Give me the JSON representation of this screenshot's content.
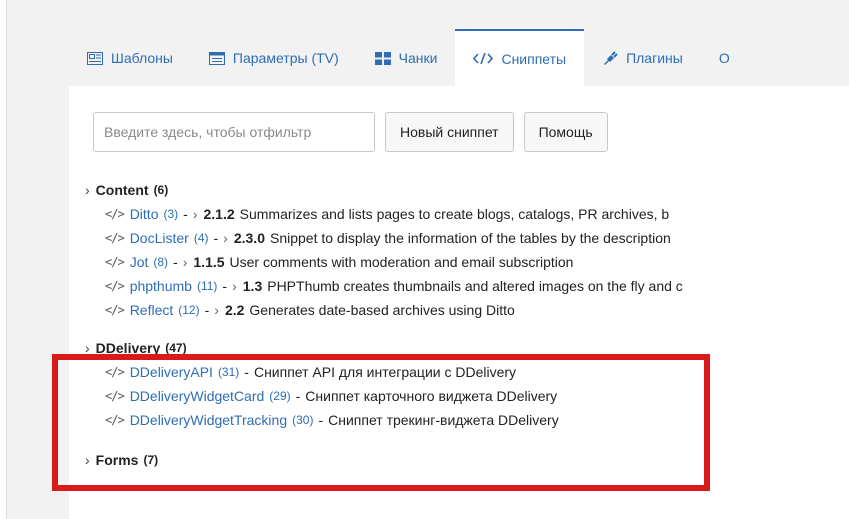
{
  "tabs": [
    {
      "label": "Шаблоны",
      "icon": "templates-icon"
    },
    {
      "label": "Параметры (TV)",
      "icon": "tv-list-icon"
    },
    {
      "label": "Чанки",
      "icon": "chunks-grid-icon"
    },
    {
      "label": "Сниппеты",
      "icon": "code-icon",
      "active": true
    },
    {
      "label": "Плагины",
      "icon": "plug-icon"
    },
    {
      "label": "О",
      "icon": ""
    }
  ],
  "toolbar": {
    "filter_placeholder": "Введите здесь, чтобы отфильтр",
    "new_snippet_label": "Новый сниппет",
    "help_label": "Помощь"
  },
  "categories": [
    {
      "name": "Content",
      "count": "(6)",
      "items": [
        {
          "name": "Ditto",
          "count": "(3)",
          "version": "2.1.2",
          "desc": "Summarizes and lists pages to create blogs, catalogs, PR archives, b"
        },
        {
          "name": "DocLister",
          "count": "(4)",
          "version": "2.3.0",
          "desc": "Snippet to display the information of the tables by the description"
        },
        {
          "name": "Jot",
          "count": "(8)",
          "version": "1.1.5",
          "desc": "User comments with moderation and email subscription"
        },
        {
          "name": "phpthumb",
          "count": "(11)",
          "version": "1.3",
          "desc": "PHPThumb creates thumbnails and altered images on the fly and c"
        },
        {
          "name": "Reflect",
          "count": "(12)",
          "version": "2.2",
          "desc": "Generates date-based archives using Ditto"
        }
      ]
    },
    {
      "name": "DDelivery",
      "count": "(47)",
      "items": [
        {
          "name": "DDeliveryAPI",
          "count": "(31)",
          "desc": "Сниппет API для интеграции с DDelivery"
        },
        {
          "name": "DDeliveryWidgetCard",
          "count": "(29)",
          "desc": "Сниппет карточного виджета DDelivery"
        },
        {
          "name": "DDeliveryWidgetTracking",
          "count": "(30)",
          "desc": "Сниппет трекинг-виджета DDelivery"
        }
      ]
    },
    {
      "name": "Forms",
      "count": "(7)",
      "items": []
    }
  ],
  "colors": {
    "accent": "#2e6db4",
    "highlight": "#d81a1a",
    "background": "#f2f2f2"
  }
}
